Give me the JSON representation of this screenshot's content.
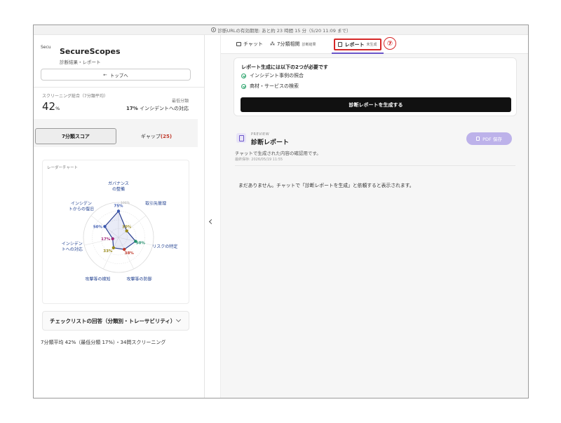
{
  "topbar": {
    "text": "診断URLの有効期限: あと約 23 時間 15 分（5/20 11:09 まで）"
  },
  "sidebar": {
    "logo_alt": "Secu",
    "app_name": "SecureScopes",
    "app_subtitle": "診断結果・レポート",
    "back_label": "トップへ",
    "score": {
      "label": "スクリーニング総合（7分類平均）",
      "value": "42",
      "unit": "%"
    },
    "lowest": {
      "label": "最低分類",
      "value": "17%",
      "name": "インシデントへの対応"
    },
    "tabs": [
      {
        "label": "7分類スコア"
      },
      {
        "label": "ギャップ",
        "count": "(25)"
      }
    ],
    "radar": {
      "title": "レーダーチャート",
      "axes": [
        {
          "line1": "ガバナンス",
          "line2": "の整備",
          "value": 75,
          "label": "75%",
          "color": "#3a58b0"
        },
        {
          "line1": "取引先管理",
          "line2": "",
          "value": 30,
          "label": "30%",
          "color": "#9a8a1a"
        },
        {
          "line1": "リスクの特定",
          "line2": "",
          "value": 50,
          "label": "50%",
          "color": "#1f8f6b"
        },
        {
          "line1": "攻撃等の防御",
          "line2": "",
          "value": 38,
          "label": "38%",
          "color": "#c0392b"
        },
        {
          "line1": "攻撃等の検知",
          "line2": "",
          "value": 33,
          "label": "33%",
          "color": "#9a8a1a"
        },
        {
          "line1": "インシデン",
          "line2": "トへの対応",
          "value": 17,
          "label": "17%",
          "color": "#a0287a"
        },
        {
          "line1": "インシデン",
          "line2": "トからの復旧",
          "value": 50,
          "label": "50%",
          "color": "#3a58b0"
        }
      ],
      "gridLabel": "100%"
    },
    "checklist_label": "チェックリストの回答（分類別・トレーサビリティ）",
    "summary": "7分類平均 42%（最低分類 17%）・34問スクリーニング"
  },
  "main": {
    "tabs": [
      {
        "label": "チャット",
        "sub": ""
      },
      {
        "label": "7分類相関",
        "sub": "診断結果"
      },
      {
        "label": "レポート",
        "sub": "未生成"
      }
    ],
    "annotation_number": "⑦",
    "requirements": {
      "title": "レポート生成には以下の2つが必要です",
      "items": [
        "インシデント事例の照合",
        "商材・サービスの検索"
      ],
      "button_label": "診断レポートを生成する"
    },
    "preview": {
      "kicker": "PREVIEW",
      "title": "診断レポート",
      "pdf_label": "PDF 保存",
      "description": "チャットで生成された内容の確認用です。",
      "saved": "最終保存: 2026/05/19 11:55",
      "empty_message": "まだありません。チャットで「診断レポートを生成」と依頼すると表示されます。"
    }
  }
}
